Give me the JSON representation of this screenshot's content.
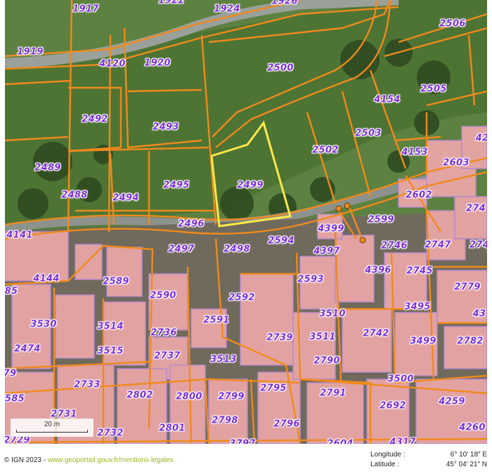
{
  "map": {
    "parcel_color": "#f08a1c",
    "label_color": "#7b2fd6",
    "building_fill": "#e9a6a6",
    "building_outline": "#b88bd0",
    "selection_color": "#ffe94a",
    "selected_parcel": "2499",
    "parcels": [
      "1917",
      "1922",
      "1924",
      "1926",
      "2506",
      "1919",
      "4120",
      "1920",
      "2500",
      "2505",
      "2492",
      "2493",
      "4154",
      "2503",
      "4153",
      "42",
      "2489",
      "2502",
      "2603",
      "2495",
      "2499",
      "2488",
      "2494",
      "2602",
      "274",
      "2496",
      "2599",
      "4141",
      "2497",
      "2498",
      "2594",
      "4399",
      "2746",
      "2747",
      "274",
      "4397",
      "4396",
      "4144",
      "2589",
      "2745",
      "2593",
      "2779",
      "85",
      "2590",
      "2592",
      "3510",
      "3495",
      "43",
      "2591",
      "3530",
      "3514",
      "2736",
      "2739",
      "3511",
      "2742",
      "3499",
      "2782",
      "2474",
      "3515",
      "2737",
      "3513",
      "2790",
      "79",
      "2733",
      "2795",
      "3500",
      "2802",
      "2800",
      "2799",
      "2791",
      "585",
      "2692",
      "4259",
      "2731",
      "2798",
      "2796",
      "2801",
      "2732",
      "2729",
      "4260",
      "3797",
      "2604",
      "4317"
    ]
  },
  "scale": {
    "label": "20 m"
  },
  "footer": {
    "copyright": "© IGN 2023 - ",
    "link": "www.geoportail.gouv.fr/mentions-legales",
    "longitude_label": "Longitude :",
    "longitude_value": "6° 10′ 18″ E",
    "latitude_label": "Latitude :",
    "latitude_value": "45° 04′ 21″ N"
  }
}
